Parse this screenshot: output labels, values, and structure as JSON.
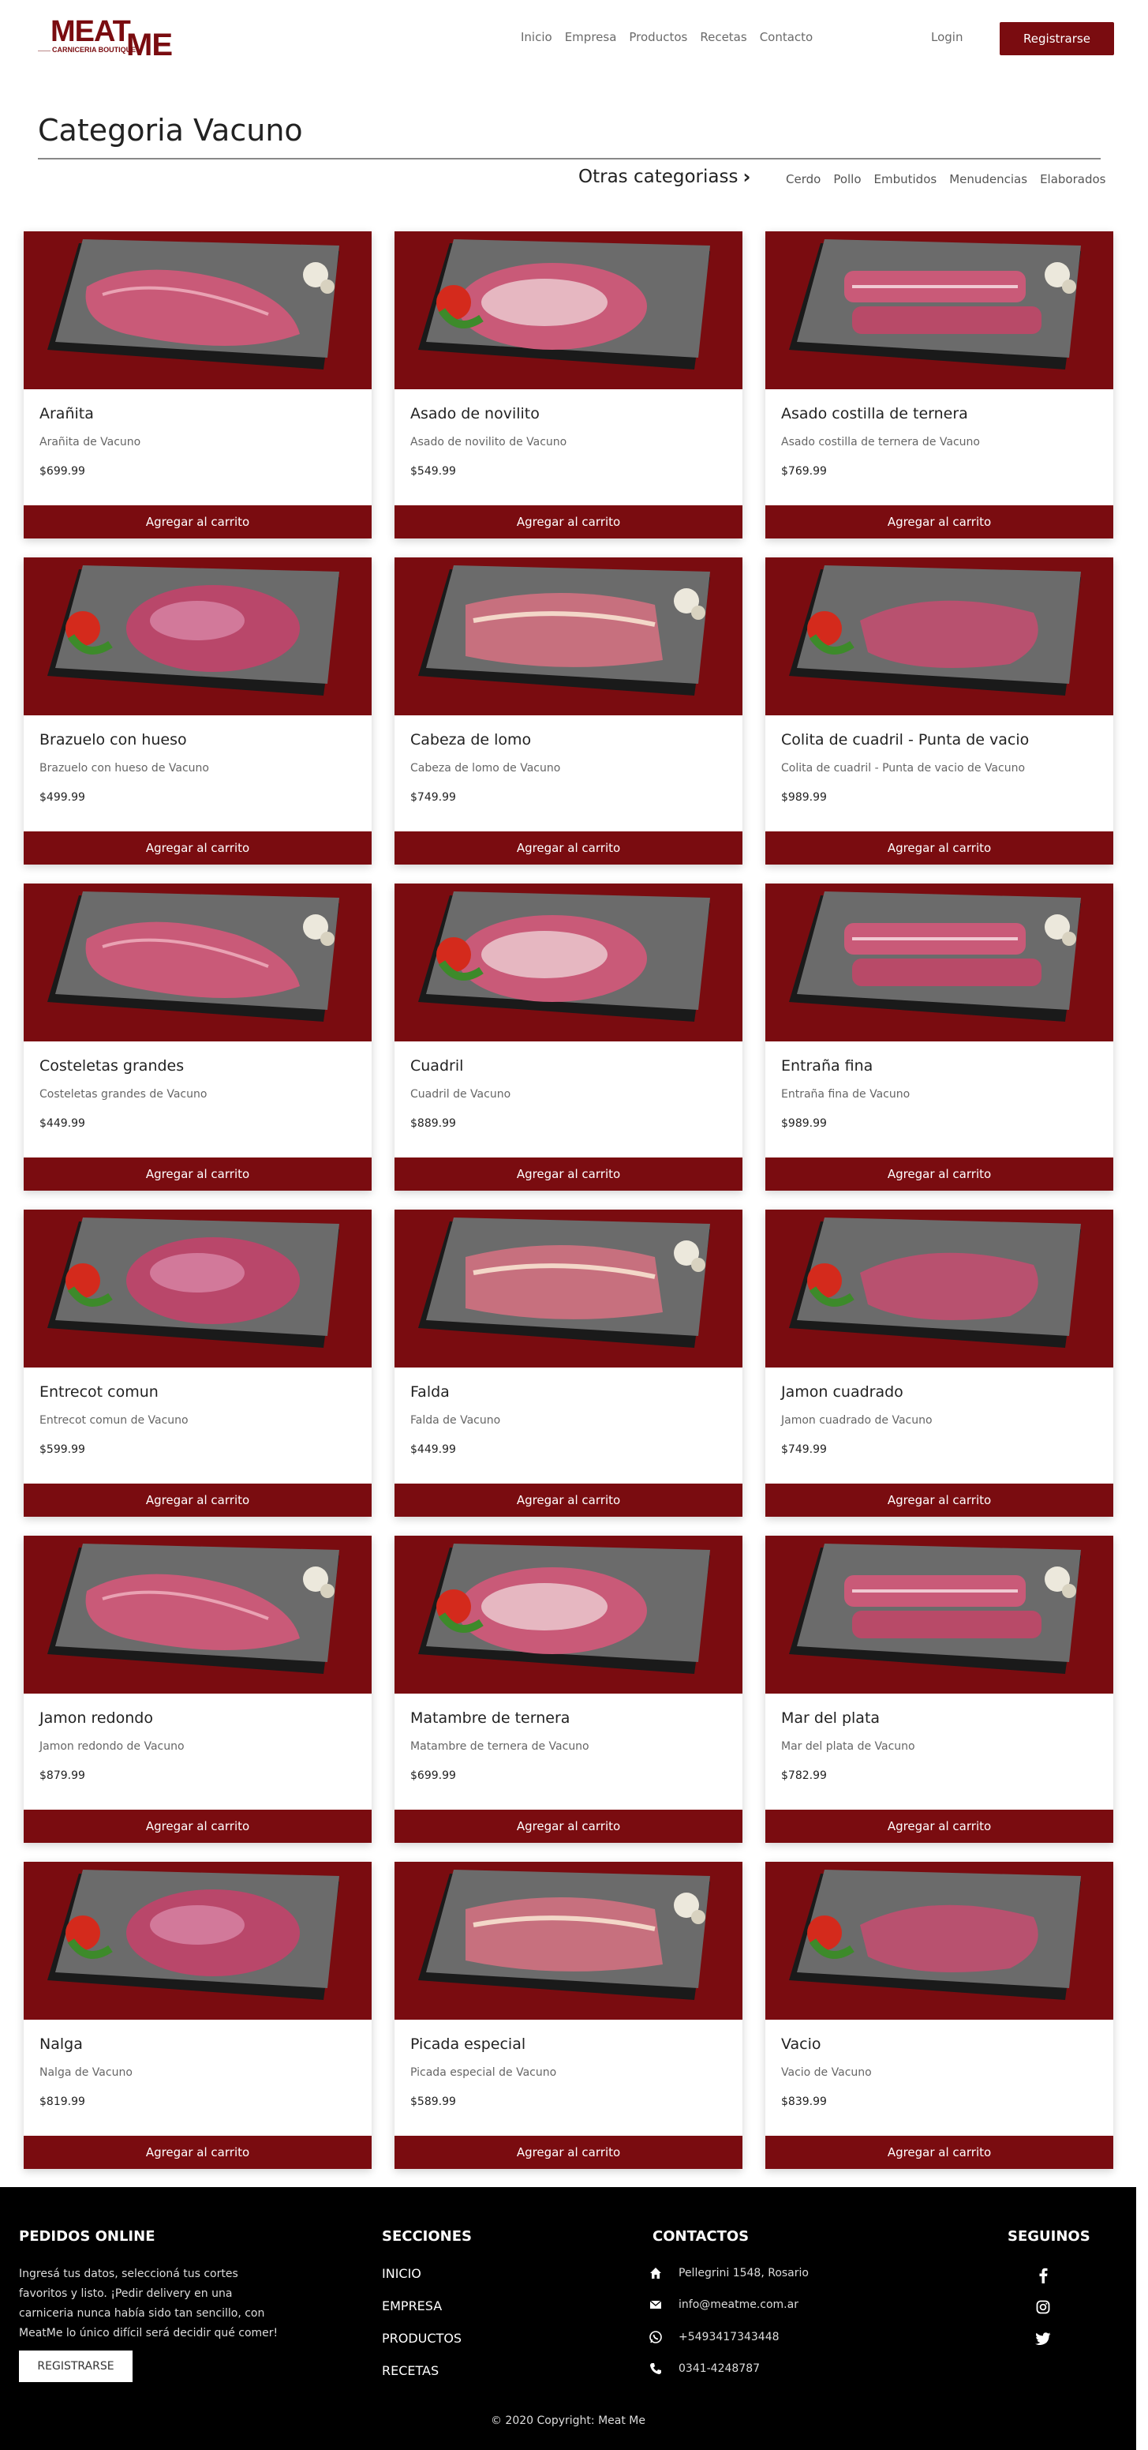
{
  "brand": {
    "line1": "MEAT",
    "line2": "ME",
    "tagline": "CARNICERIA BOUTIQUE",
    "color": "#7a0c10"
  },
  "nav": {
    "links": [
      "Inicio",
      "Empresa",
      "Productos",
      "Recetas",
      "Contacto"
    ],
    "login": "Login",
    "register": "Registrarse"
  },
  "header": {
    "title": "Categoria Vacuno",
    "other_label": "Otras categoriass",
    "categories": [
      "Cerdo",
      "Pollo",
      "Embutidos",
      "Menudencias",
      "Elaborados"
    ]
  },
  "products": [
    {
      "name": "Arañita",
      "desc": "Arañita de Vacuno",
      "price": "$699.99"
    },
    {
      "name": "Asado de novilito",
      "desc": "Asado de novilito de Vacuno",
      "price": "$549.99"
    },
    {
      "name": "Asado costilla de ternera",
      "desc": "Asado costilla de ternera de Vacuno",
      "price": "$769.99"
    },
    {
      "name": "Brazuelo con hueso",
      "desc": "Brazuelo con hueso de Vacuno",
      "price": "$499.99"
    },
    {
      "name": "Cabeza de lomo",
      "desc": "Cabeza de lomo de Vacuno",
      "price": "$749.99"
    },
    {
      "name": "Colita de cuadril - Punta de vacio",
      "desc": "Colita de cuadril - Punta de vacio de Vacuno",
      "price": "$989.99"
    },
    {
      "name": "Costeletas grandes",
      "desc": "Costeletas grandes de Vacuno",
      "price": "$449.99"
    },
    {
      "name": "Cuadril",
      "desc": "Cuadril de Vacuno",
      "price": "$889.99"
    },
    {
      "name": "Entraña fina",
      "desc": "Entraña fina de Vacuno",
      "price": "$989.99"
    },
    {
      "name": "Entrecot comun",
      "desc": "Entrecot comun de Vacuno",
      "price": "$599.99"
    },
    {
      "name": "Falda",
      "desc": "Falda de Vacuno",
      "price": "$449.99"
    },
    {
      "name": "Jamon cuadrado",
      "desc": "Jamon cuadrado de Vacuno",
      "price": "$749.99"
    },
    {
      "name": "Jamon redondo",
      "desc": "Jamon redondo de Vacuno",
      "price": "$879.99"
    },
    {
      "name": "Matambre de ternera",
      "desc": "Matambre de ternera de Vacuno",
      "price": "$699.99"
    },
    {
      "name": "Mar del plata",
      "desc": "Mar del plata de Vacuno",
      "price": "$782.99"
    },
    {
      "name": "Nalga",
      "desc": "Nalga de Vacuno",
      "price": "$819.99"
    },
    {
      "name": "Picada especial",
      "desc": "Picada especial de Vacuno",
      "price": "$589.99"
    },
    {
      "name": "Vacio",
      "desc": "Vacio de Vacuno",
      "price": "$839.99"
    }
  ],
  "add_to_cart_label": "Agregar al carrito",
  "footer": {
    "online_title": "PEDIDOS ONLINE",
    "online_text": "Ingresá tus datos, seleccioná tus cortes favoritos y listo. ¡Pedir delivery en una carniceria nunca había sido tan sencillo, con MeatMe lo único difícil será decidir qué comer!",
    "register": "REGISTRARSE",
    "sections_title": "SECCIONES",
    "sections": [
      "INICIO",
      "EMPRESA",
      "PRODUCTOS",
      "RECETAS"
    ],
    "contacts_title": "CONTACTOS",
    "contacts": [
      {
        "icon": "home-icon",
        "text": "Pellegrini 1548, Rosario"
      },
      {
        "icon": "envelope-icon",
        "text": "info@meatme.com.ar"
      },
      {
        "icon": "whatsapp-icon",
        "text": "+5493417343448"
      },
      {
        "icon": "phone-icon",
        "text": "0341-4248787"
      }
    ],
    "follow_title": "SEGUINOS",
    "social": [
      "facebook-icon",
      "instagram-icon",
      "twitter-icon"
    ],
    "copyright": "© 2020 Copyright: Meat Me"
  }
}
